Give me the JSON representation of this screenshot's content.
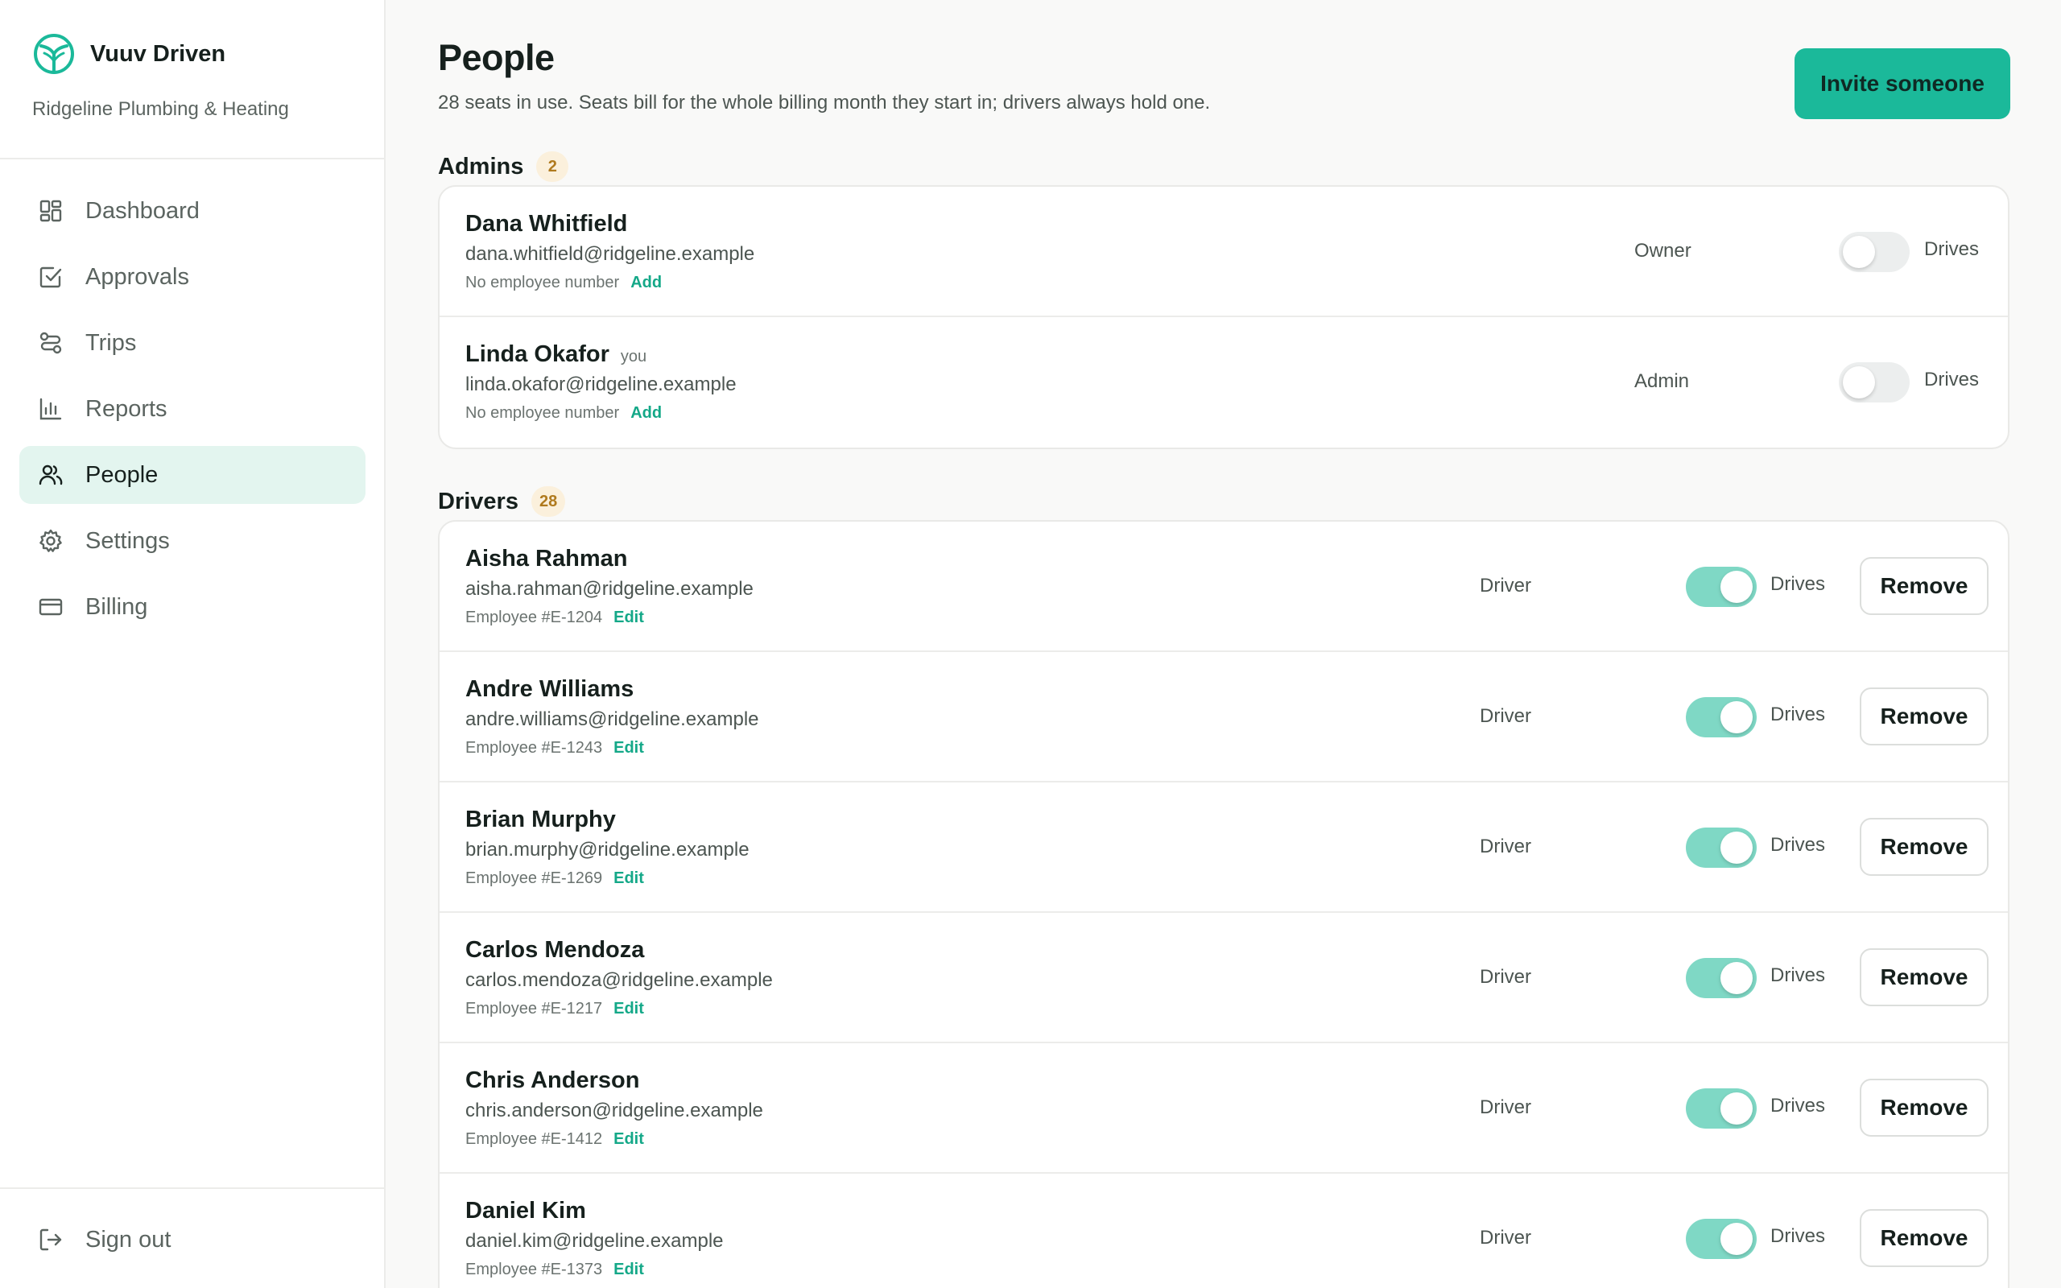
{
  "app": {
    "name": "Vuuv Driven",
    "org": "Ridgeline Plumbing & Heating",
    "logo_icon": "vuuv-logo-icon",
    "accent": "#1bb99a"
  },
  "sidebar": {
    "items": [
      {
        "label": "Dashboard",
        "icon": "grid-icon",
        "active": false
      },
      {
        "label": "Approvals",
        "icon": "check-square-icon",
        "active": false
      },
      {
        "label": "Trips",
        "icon": "route-icon",
        "active": false
      },
      {
        "label": "Reports",
        "icon": "bar-chart-icon",
        "active": false
      },
      {
        "label": "People",
        "icon": "users-icon",
        "active": true
      },
      {
        "label": "Settings",
        "icon": "gear-icon",
        "active": false
      },
      {
        "label": "Billing",
        "icon": "credit-card-icon",
        "active": false
      }
    ],
    "signout": {
      "label": "Sign out",
      "icon": "sign-out-icon"
    }
  },
  "header": {
    "title": "People",
    "subtitle": "28 seats in use. Seats bill for the whole billing month they start in; drivers always hold one.",
    "invite_label": "Invite someone"
  },
  "common": {
    "drives_label": "Drives",
    "remove_label": "Remove"
  },
  "admins": {
    "title": "Admins",
    "count": "2",
    "rows": [
      {
        "name": "Dana Whitfield",
        "you": "",
        "email": "dana.whitfield@ridgeline.example",
        "employee": "No employee number",
        "action": "Add",
        "role": "Owner",
        "drives": false
      },
      {
        "name": "Linda Okafor",
        "you": "you",
        "email": "linda.okafor@ridgeline.example",
        "employee": "No employee number",
        "action": "Add",
        "role": "Admin",
        "drives": false
      }
    ]
  },
  "drivers": {
    "title": "Drivers",
    "count": "28",
    "rows": [
      {
        "name": "Aisha Rahman",
        "email": "aisha.rahman@ridgeline.example",
        "employee": "Employee #E-1204",
        "action": "Edit",
        "role": "Driver",
        "drives": true
      },
      {
        "name": "Andre Williams",
        "email": "andre.williams@ridgeline.example",
        "employee": "Employee #E-1243",
        "action": "Edit",
        "role": "Driver",
        "drives": true
      },
      {
        "name": "Brian Murphy",
        "email": "brian.murphy@ridgeline.example",
        "employee": "Employee #E-1269",
        "action": "Edit",
        "role": "Driver",
        "drives": true
      },
      {
        "name": "Carlos Mendoza",
        "email": "carlos.mendoza@ridgeline.example",
        "employee": "Employee #E-1217",
        "action": "Edit",
        "role": "Driver",
        "drives": true
      },
      {
        "name": "Chris Anderson",
        "email": "chris.anderson@ridgeline.example",
        "employee": "Employee #E-1412",
        "action": "Edit",
        "role": "Driver",
        "drives": true
      },
      {
        "name": "Daniel Kim",
        "email": "daniel.kim@ridgeline.example",
        "employee": "Employee #E-1373",
        "action": "Edit",
        "role": "Driver",
        "drives": true
      }
    ]
  }
}
